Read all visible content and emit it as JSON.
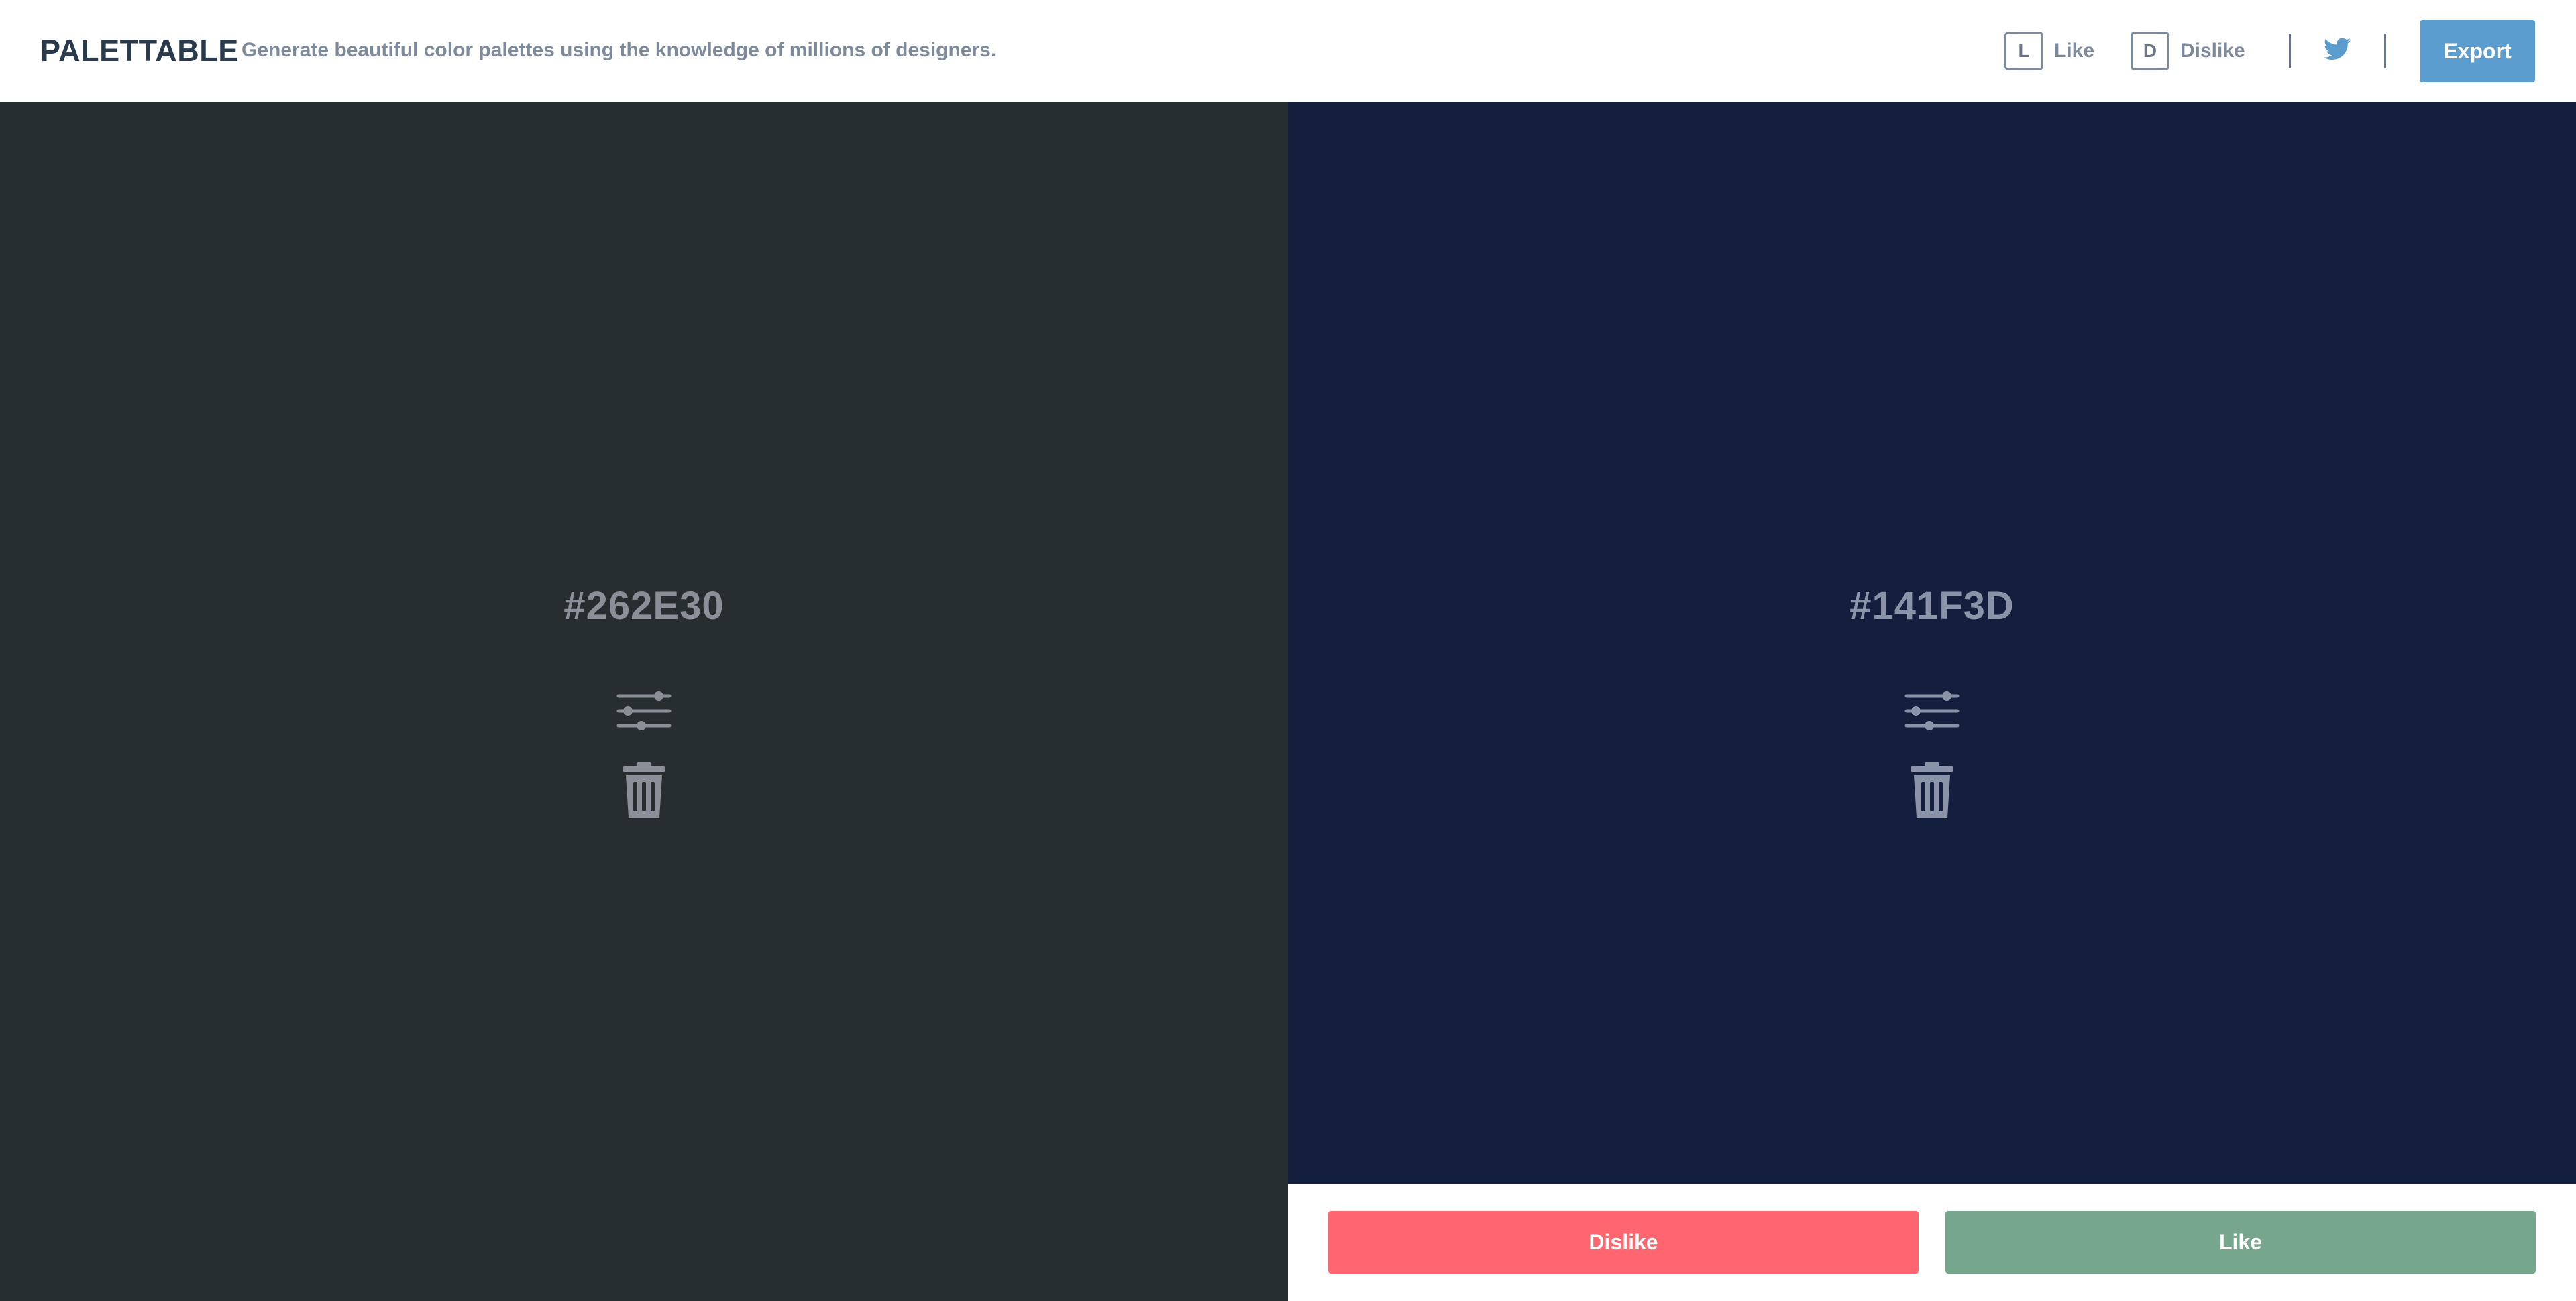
{
  "app": {
    "logo": "PALETTABLE",
    "tagline": "Generate beautiful color palettes using the knowledge of millions of designers."
  },
  "header": {
    "shortcuts": [
      {
        "key": "L",
        "label": "Like"
      },
      {
        "key": "D",
        "label": "Dislike"
      }
    ],
    "twitter_icon": "twitter-icon",
    "export_label": "Export"
  },
  "palette": {
    "colors": [
      {
        "hex": "#262E30",
        "value": "#262e30",
        "adjust_icon": "sliders-icon",
        "delete_icon": "trash-icon"
      },
      {
        "hex": "#141F3D",
        "value": "#141f3d",
        "adjust_icon": "sliders-icon",
        "delete_icon": "trash-icon"
      }
    ]
  },
  "actions": {
    "dislike_label": "Dislike",
    "like_label": "Like"
  },
  "theme": {
    "export_color": "#5b9dcf",
    "dislike_color": "#ff6670",
    "like_color": "#76a68b",
    "twitter_color": "#5b9dcf",
    "logo_color": "#2a3a4d",
    "muted_text": "#7d8a9c"
  }
}
